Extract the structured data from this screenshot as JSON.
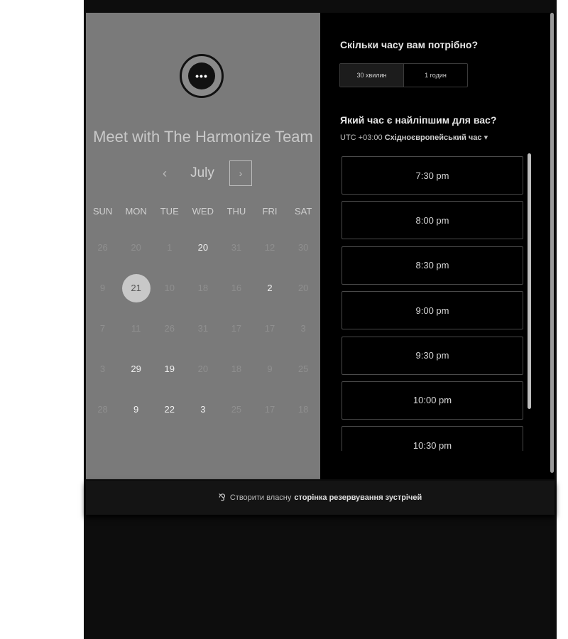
{
  "calendar": {
    "title": "Meet with The Harmonize Team",
    "month": "July",
    "prev_icon": "‹",
    "next_icon": "›",
    "weekdays": [
      "SUN",
      "MON",
      "TUE",
      "WED",
      "THU",
      "FRI",
      "SAT"
    ],
    "weeks": [
      [
        {
          "d": "26",
          "a": false
        },
        {
          "d": "20",
          "a": false
        },
        {
          "d": "1",
          "a": false
        },
        {
          "d": "20",
          "a": true
        },
        {
          "d": "31",
          "a": false
        },
        {
          "d": "12",
          "a": false
        },
        {
          "d": "30",
          "a": false
        }
      ],
      [
        {
          "d": "9",
          "a": false
        },
        {
          "d": "21",
          "a": true,
          "s": true
        },
        {
          "d": "10",
          "a": false
        },
        {
          "d": "18",
          "a": false
        },
        {
          "d": "16",
          "a": false
        },
        {
          "d": "2",
          "a": true
        },
        {
          "d": "20",
          "a": false
        }
      ],
      [
        {
          "d": "7",
          "a": false
        },
        {
          "d": "11",
          "a": false
        },
        {
          "d": "26",
          "a": false
        },
        {
          "d": "31",
          "a": false
        },
        {
          "d": "17",
          "a": false
        },
        {
          "d": "17",
          "a": false
        },
        {
          "d": "3",
          "a": false
        }
      ],
      [
        {
          "d": "3",
          "a": false
        },
        {
          "d": "29",
          "a": true
        },
        {
          "d": "19",
          "a": true
        },
        {
          "d": "20",
          "a": false
        },
        {
          "d": "18",
          "a": false
        },
        {
          "d": "9",
          "a": false
        },
        {
          "d": "25",
          "a": false
        }
      ],
      [
        {
          "d": "28",
          "a": false
        },
        {
          "d": "9",
          "a": true
        },
        {
          "d": "22",
          "a": true
        },
        {
          "d": "3",
          "a": true
        },
        {
          "d": "25",
          "a": false
        },
        {
          "d": "17",
          "a": false
        },
        {
          "d": "18",
          "a": false
        }
      ]
    ]
  },
  "scheduler": {
    "duration_question": "Скільки часу вам потрібно?",
    "durations": [
      "30 хвилин",
      "1 годин"
    ],
    "time_question": "Який час є найліпшим для вас?",
    "tz_offset": "UTC +03:00",
    "tz_name": "Східноєвропейський час",
    "tz_caret": "▾",
    "slots": [
      "7:30 pm",
      "8:00 pm",
      "8:30 pm",
      "9:00 pm",
      "9:30 pm",
      "10:00 pm",
      "10:30 pm"
    ]
  },
  "footer": {
    "icon": "⅋",
    "prefix": "Створити власну",
    "link": "сторінка резервування зустрічей"
  }
}
